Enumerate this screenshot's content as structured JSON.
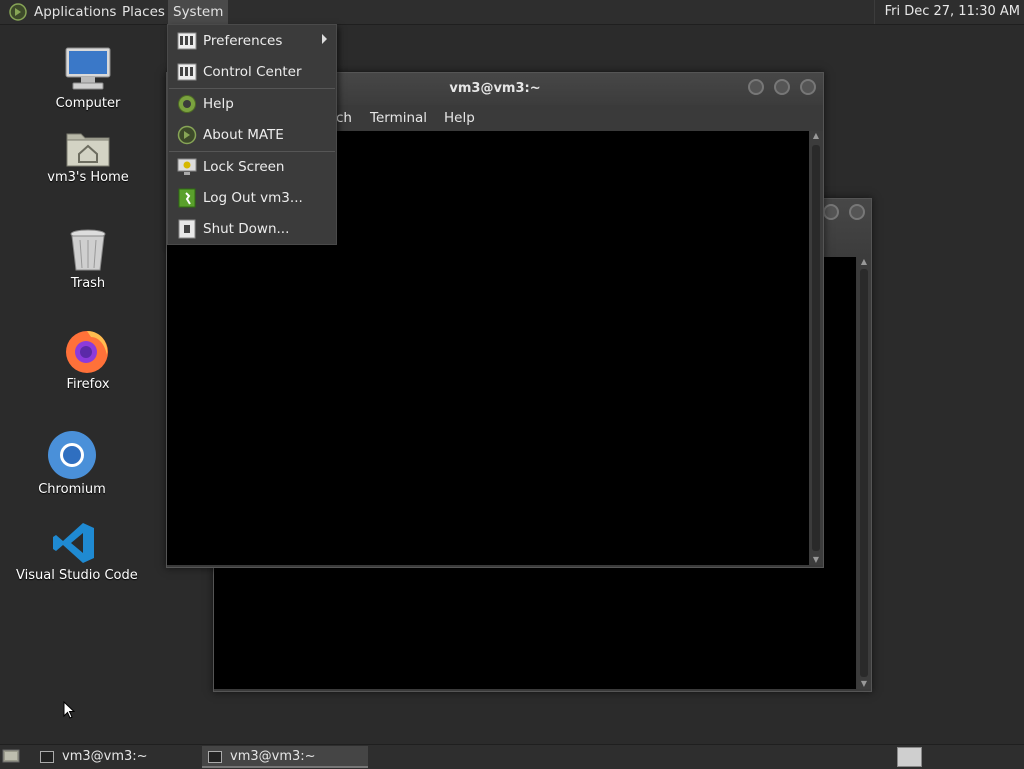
{
  "top_panel": {
    "menus": [
      "Applications",
      "Places",
      "System"
    ],
    "clock": "Fri Dec 27, 11:30 AM"
  },
  "desktop_icons": [
    {
      "label": "Computer",
      "icon": "computer-icon"
    },
    {
      "label": "vm3's Home",
      "icon": "home-folder-icon"
    },
    {
      "label": "Trash",
      "icon": "trash-icon"
    },
    {
      "label": "Firefox",
      "icon": "firefox-icon"
    },
    {
      "label": "Chromium",
      "icon": "chromium-icon"
    },
    {
      "label": "Visual Studio Code",
      "icon": "vscode-icon"
    }
  ],
  "terminal_front": {
    "title": "vm3@vm3:~",
    "menu": [
      "ch",
      "Terminal",
      "Help"
    ]
  },
  "system_menu": {
    "items": [
      {
        "label": "Preferences",
        "icon": "preferences-icon",
        "submenu": true
      },
      {
        "label": "Control Center",
        "icon": "control-center-icon"
      },
      {
        "label": "Help",
        "icon": "help-icon"
      },
      {
        "label": "About MATE",
        "icon": "mate-logo-icon"
      },
      {
        "label": "Lock Screen",
        "icon": "lock-screen-icon"
      },
      {
        "label": "Log Out vm3...",
        "icon": "logout-icon"
      },
      {
        "label": "Shut Down...",
        "icon": "shutdown-icon"
      }
    ]
  },
  "taskbar": {
    "tasks": [
      "vm3@vm3:~",
      "vm3@vm3:~"
    ]
  }
}
